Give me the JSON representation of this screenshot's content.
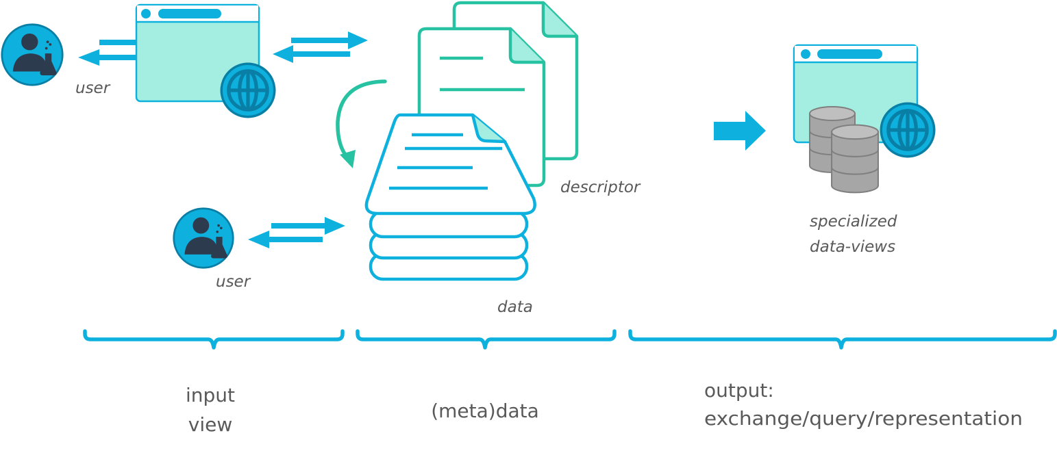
{
  "colors": {
    "blue": "#0EB1DD",
    "teal": "#26C2A2",
    "mint_fill": "#A3EEE0",
    "navy": "#2D3B4E",
    "gray": "#A6A6A6",
    "text": "#595959"
  },
  "labels": {
    "user_top": "user",
    "user_bottom": "user",
    "descriptor": "descriptor",
    "data": "data",
    "views_line1": "specialized",
    "views_line2": "data-views"
  },
  "sections": {
    "input_line1": "input",
    "input_line2": "view",
    "metadata": "(meta)data",
    "output_line1": "output:",
    "output_line2": "exchange/query/representation"
  },
  "icons": [
    "user-scientist-icon",
    "browser-window-icon",
    "globe-icon",
    "document-icon",
    "database-icon",
    "arrow-right-icon",
    "bidirectional-arrows-icon",
    "curly-brace-icon"
  ]
}
